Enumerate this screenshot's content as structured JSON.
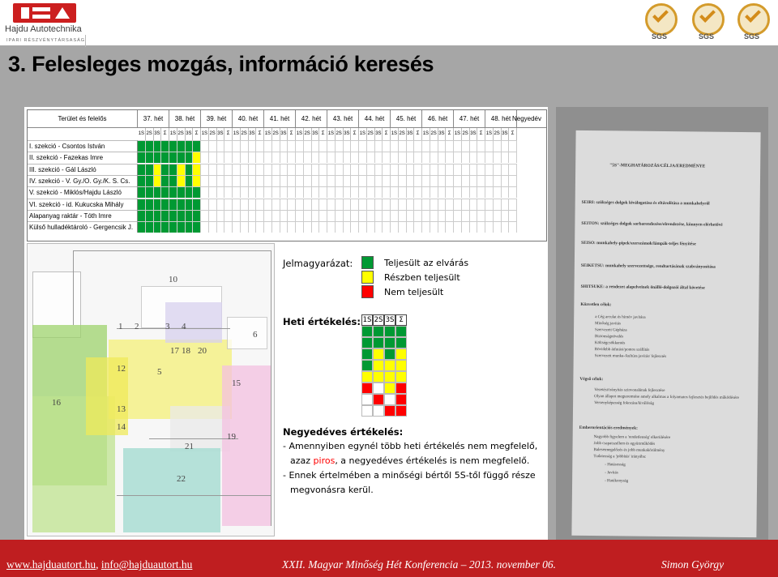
{
  "header": {
    "logo_text": "Hajdu Autotechnika",
    "logo_sub": "IPARI RÉSZVÉNYTÁRSASÁG",
    "cert_label": "SGS"
  },
  "slide_title": "3. Felesleges mozgás, információ keresés",
  "schedule": {
    "area_header": "Terület és felelős",
    "weeks": [
      "37. hét",
      "38. hét",
      "39. hét",
      "40. hét",
      "41. hét",
      "42. hét",
      "43. hét",
      "44. hét",
      "45. hét",
      "46. hét",
      "47. hét",
      "48. hét"
    ],
    "quarter_header": "Negyedév",
    "sub_headers": [
      "1S",
      "2S",
      "3S",
      "Σ"
    ],
    "rows": [
      "I. szekció - Csontos István",
      "II. szekció - Fazekas Imre",
      "III. szekció - Gál László",
      "IV. szekció - V. Gy./O. Gy./K. S. Cs.",
      "V. szekció - Miklós/Hajdu László",
      "VI. szekció - id. Kukucska Mihály",
      "Alapanyag raktár - Tóth Imre",
      "Külső hulladéktároló - Gergencsik J."
    ],
    "colors": {
      "green": "#009933",
      "yellow": "#ffff00",
      "red": "#ff0000"
    }
  },
  "legend": {
    "title": "Jelmagyarázat:",
    "items": [
      "Teljesült az elvárás",
      "Részben teljesült",
      "Nem teljesült"
    ],
    "weekly_label": "Heti értékelés:",
    "weekly_cells": [
      "1S",
      "2S",
      "3S",
      "Σ"
    ],
    "quarterly_label": "Negyedéves értékelés:",
    "quarterly_lines": [
      "- Amennyiben egynél több heti értékelés nem megfelelő,",
      "azaz",
      "piros",
      ", a negyedéves értékelés is nem megfelelő.",
      "- Ennek értelmében a minőségi bértől 5S-től függő része",
      "megvonásra kerül."
    ]
  },
  "photo_doc": {
    "heading": "\"5S\"-MEGHATÁROZÁS/CÉLJA/EREDMÉNYE",
    "lines": [
      "SEIRI: szükséges dolgok kiválogatása és eltávolítása a munkahelyről",
      "SEITON: szükséges dolgok sorbarendezése/elrendezése, könnyen elérhetővé",
      "SEISO: munkahely-pipek/szerszámok/lámpák-teljes fényítése",
      "SEIKETSU: munkahely szervezettsége, rendtartásának szabványosítása",
      "SHITSUKE: a rendezet alapelveinek önálló-dolgozói által követése",
      "Közvetlen célok:",
      "a Cég arculat és hírnév javítása",
      "Minőség javítás",
      "Szervezett Gépháza",
      "Biztonságnövelés",
      "Költségcsökkentés",
      "Rövidebb átfutási/pontos szállítás",
      "Szervezett munka-/kultúra javítás/ fejlesztés",
      "Végső célok:",
      "Vezetési/irányítás szinvonalának fejlesztése",
      "Olyan állapot megteremtése amely alkalmas a folyamatos fejlesztés bejlődés működésére",
      "Versenyképesség fokozása/kiválóság",
      "Emberorientációs eredmények:",
      "Nagyobb figyelem a 'rendetlenség' elkerülésére",
      "Jobb csapatszellem és együttműködés",
      "Balesetmegelőzés és jobb munkakörülmény",
      "Tudatosság a 'jobbítás' irányába:",
      "- Hatásosság",
      "- Javítás",
      "- Hatékonyság"
    ]
  },
  "floor_plan": {
    "numbers": [
      "1",
      "2",
      "3",
      "4",
      "5",
      "6",
      "10",
      "12",
      "13",
      "14",
      "15",
      "16",
      "17",
      "18",
      "19",
      "20",
      "21",
      "22"
    ]
  },
  "footer": {
    "website": "www.hajduautort.hu",
    "separator": ",",
    "email": "info@hajduautort.hu",
    "conference": "XXII. Magyar Minőség Hét Konferencia – 2013. november 06.",
    "author": "Simon György"
  }
}
